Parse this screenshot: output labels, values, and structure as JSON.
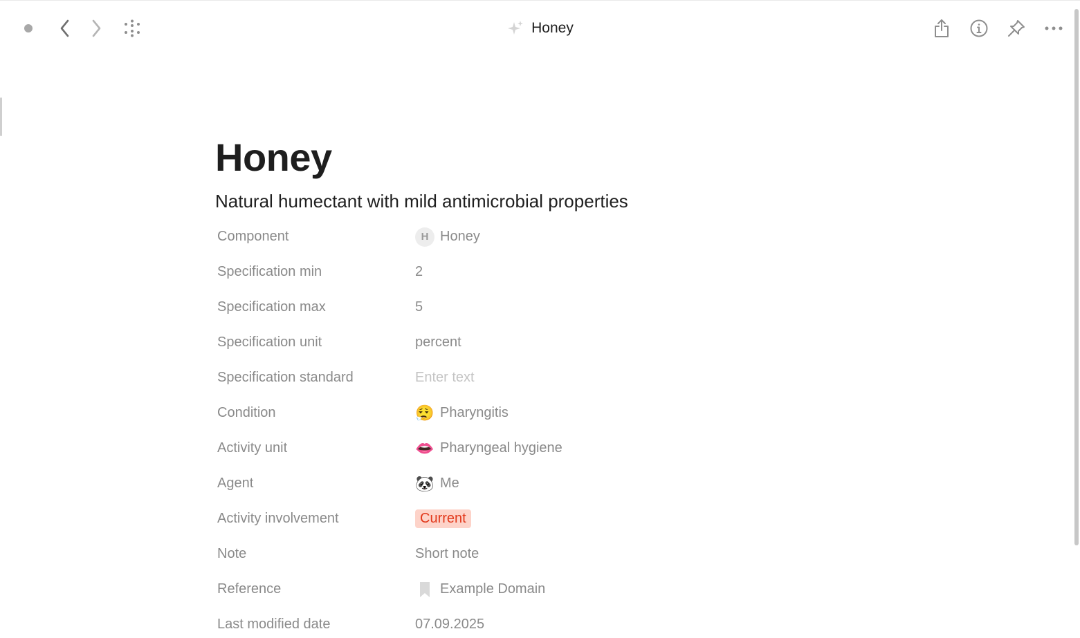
{
  "header": {
    "title": "Honey",
    "title_icon": "sparkle-icon"
  },
  "page": {
    "title": "Honey",
    "subtitle": "Natural humectant with mild antimicrobial properties"
  },
  "properties": {
    "component": {
      "label": "Component",
      "value": "Honey",
      "avatar_letter": "H"
    },
    "spec_min": {
      "label": "Specification min",
      "value": "2"
    },
    "spec_max": {
      "label": "Specification max",
      "value": "5"
    },
    "spec_unit": {
      "label": "Specification unit",
      "value": "percent"
    },
    "spec_standard": {
      "label": "Specification standard",
      "placeholder": "Enter text"
    },
    "condition": {
      "label": "Condition",
      "value": "Pharyngitis",
      "emoji": "😮‍💨"
    },
    "activity_unit": {
      "label": "Activity unit",
      "value": "Pharyngeal hygiene",
      "emoji": "👄"
    },
    "agent": {
      "label": "Agent",
      "value": "Me",
      "emoji": "🐼"
    },
    "activity_involvement": {
      "label": "Activity involvement",
      "value": "Current",
      "badge_bg": "#fdd3c9",
      "badge_color": "#e2381b"
    },
    "note": {
      "label": "Note",
      "value": "Short note"
    },
    "reference": {
      "label": "Reference",
      "value": "Example Domain",
      "icon": "bookmark-icon"
    },
    "last_modified": {
      "label": "Last modified date",
      "value": "07.09.2025"
    }
  },
  "colors": {
    "label": "#8a8a8a",
    "placeholder": "#c4c4c4",
    "toolbar_icon": "#8e8e8e"
  }
}
